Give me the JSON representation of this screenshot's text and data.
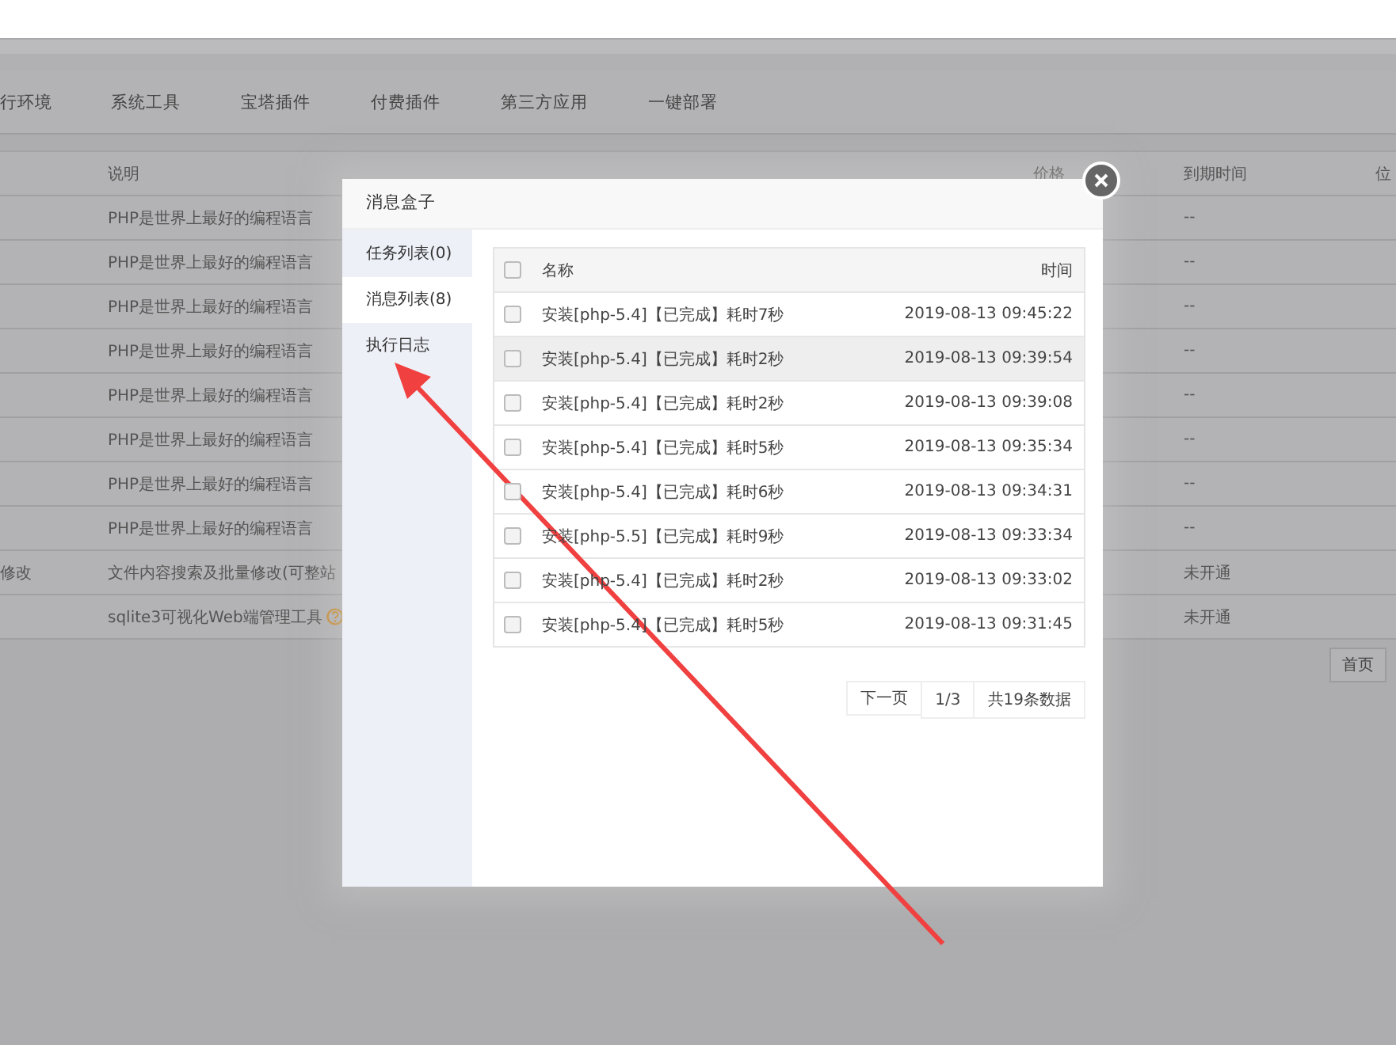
{
  "page": {
    "nav_tabs": [
      {
        "label": "行环境"
      },
      {
        "label": "系统工具"
      },
      {
        "label": "宝塔插件"
      },
      {
        "label": "付费插件"
      },
      {
        "label": "第三方应用"
      },
      {
        "label": "一键部署"
      }
    ],
    "table": {
      "headers": [
        "说明",
        "价格",
        "到期时间",
        "位"
      ],
      "rows": [
        {
          "description": "PHP是世界上最好的编程语言",
          "expiry": "--"
        },
        {
          "description": "PHP是世界上最好的编程语言",
          "expiry": "--"
        },
        {
          "description": "PHP是世界上最好的编程语言",
          "expiry": "--"
        },
        {
          "description": "PHP是世界上最好的编程语言",
          "expiry": "--"
        },
        {
          "description": "PHP是世界上最好的编程语言",
          "expiry": "--"
        },
        {
          "description": "PHP是世界上最好的编程语言",
          "expiry": "--"
        },
        {
          "description": "PHP是世界上最好的编程语言",
          "expiry": "--"
        },
        {
          "description": "PHP是世界上最好的编程语言",
          "expiry": "--"
        },
        {
          "column_1": "修改",
          "description": "文件内容搜索及批量修改(可整站",
          "expiry": "未开通"
        },
        {
          "description": "sqlite3可视化Web端管理工具",
          "help_icon": true,
          "expiry": "未开通"
        }
      ]
    },
    "pagination": [
      "首页"
    ]
  },
  "modal": {
    "title": "消息盒子",
    "sidebar": [
      {
        "label": "任务列表(0)",
        "selected": false
      },
      {
        "label": "消息列表(8)",
        "selected": true
      },
      {
        "label": "执行日志",
        "selected": false
      }
    ],
    "columns": [
      "名称",
      "时间"
    ],
    "header_checked": false,
    "rows": [
      {
        "name": "安装[php-5.4]【已完成】耗时7秒",
        "time": "2019-08-13 09:45:22",
        "checked": false,
        "hovered": false
      },
      {
        "name": "安装[php-5.4]【已完成】耗时2秒",
        "time": "2019-08-13 09:39:54",
        "checked": false,
        "hovered": true
      },
      {
        "name": "安装[php-5.4]【已完成】耗时2秒",
        "time": "2019-08-13 09:39:08",
        "checked": false,
        "hovered": false
      },
      {
        "name": "安装[php-5.4]【已完成】耗时5秒",
        "time": "2019-08-13 09:35:34",
        "checked": false,
        "hovered": false
      },
      {
        "name": "安装[php-5.4]【已完成】耗时6秒",
        "time": "2019-08-13 09:34:31",
        "checked": false,
        "hovered": false
      },
      {
        "name": "安装[php-5.5]【已完成】耗时9秒",
        "time": "2019-08-13 09:33:34",
        "checked": false,
        "hovered": false
      },
      {
        "name": "安装[php-5.4]【已完成】耗时2秒",
        "time": "2019-08-13 09:33:02",
        "checked": false,
        "hovered": false
      },
      {
        "name": "安装[php-5.4]【已完成】耗时5秒",
        "time": "2019-08-13 09:31:45",
        "checked": false,
        "hovered": false
      }
    ],
    "pagination": [
      "下一页",
      "1/3",
      "共19条数据"
    ]
  }
}
